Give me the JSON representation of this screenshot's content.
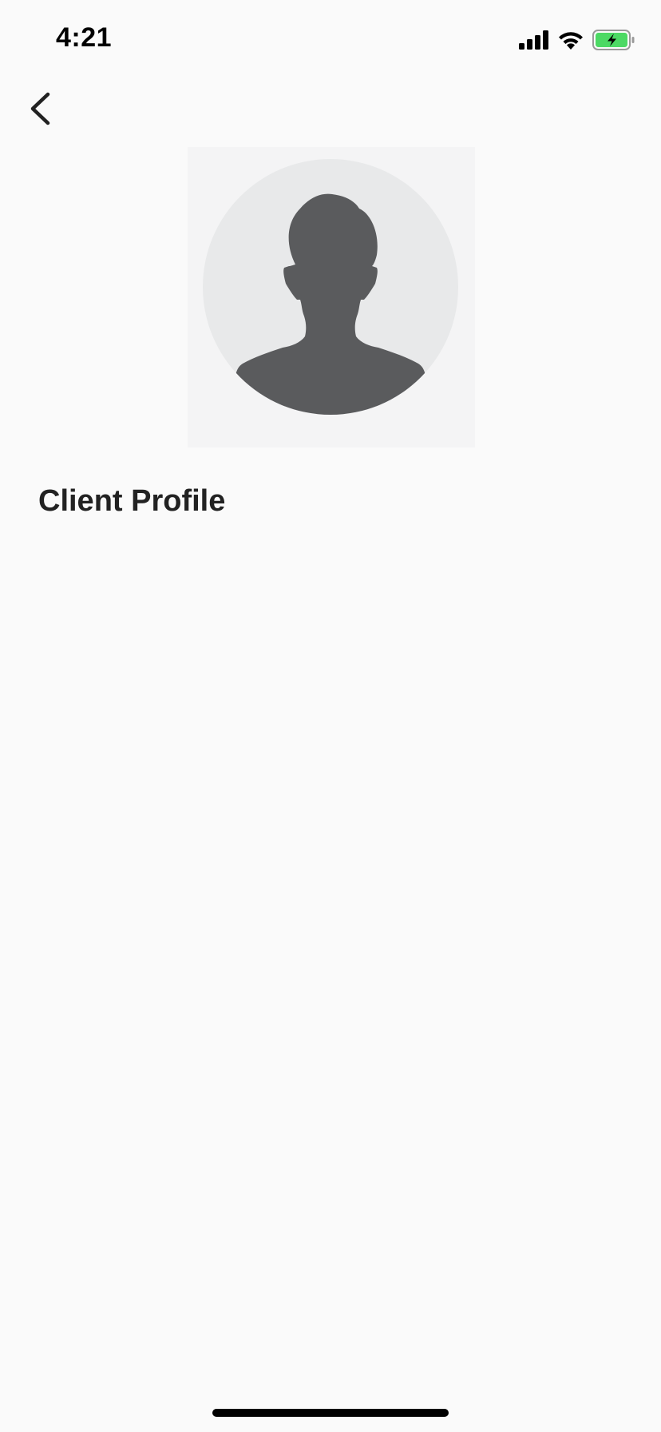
{
  "status_bar": {
    "time": "4:21",
    "icons": [
      "cellular-signal-icon",
      "wifi-icon",
      "battery-charging-icon"
    ],
    "battery_color": "#4cd964"
  },
  "nav": {
    "back_icon": "chevron-left-icon"
  },
  "profile": {
    "avatar": "default-user-silhouette",
    "title": "Client Profile"
  },
  "colors": {
    "background": "#fafafa",
    "avatar_circle": "#e8e9ea",
    "avatar_silhouette": "#5a5b5d",
    "title": "#222222"
  }
}
